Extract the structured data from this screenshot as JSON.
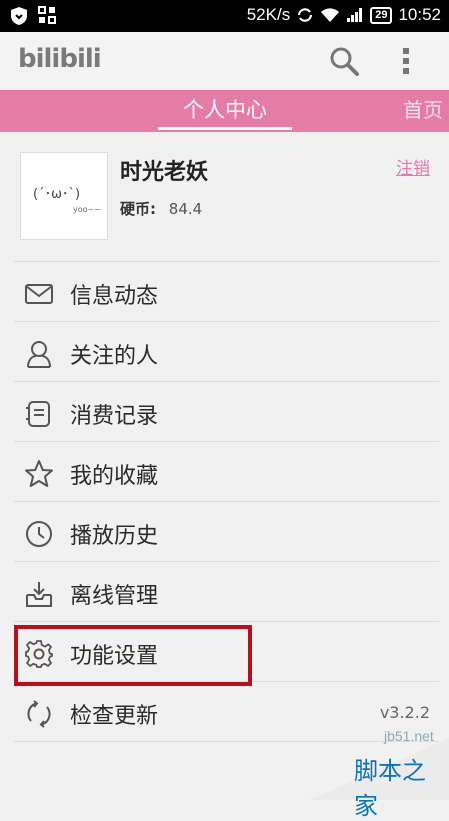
{
  "status_bar": {
    "speed": "52K/s",
    "battery": "29",
    "time": "10:52"
  },
  "app_bar": {
    "logo": "bilibili",
    "search_icon": "search-icon",
    "more_icon": "more-vert-icon"
  },
  "tabs": [
    {
      "label": "个人中心",
      "active": true
    },
    {
      "label": "首页",
      "active": false
    }
  ],
  "colors": {
    "accent": "#e57ca5",
    "highlight_border": "#b3121c"
  },
  "profile": {
    "avatar_face": "(´･ω･`)",
    "avatar_caption": "yoo~~",
    "username": "时光老妖",
    "coins_label": "硬币:",
    "coins_value": "84.4",
    "logout": "注销"
  },
  "menu": [
    {
      "label": "信息动态",
      "icon": "mail-icon"
    },
    {
      "label": "关注的人",
      "icon": "person-icon"
    },
    {
      "label": "消费记录",
      "icon": "receipt-icon"
    },
    {
      "label": "我的收藏",
      "icon": "star-icon"
    },
    {
      "label": "播放历史",
      "icon": "clock-icon"
    },
    {
      "label": "离线管理",
      "icon": "download-tray-icon"
    },
    {
      "label": "功能设置",
      "icon": "gear-icon"
    },
    {
      "label": "检查更新",
      "icon": "refresh-icon"
    }
  ],
  "version": "v3.2.2",
  "watermark": {
    "url": "jb51.net",
    "name": "脚本之家"
  }
}
